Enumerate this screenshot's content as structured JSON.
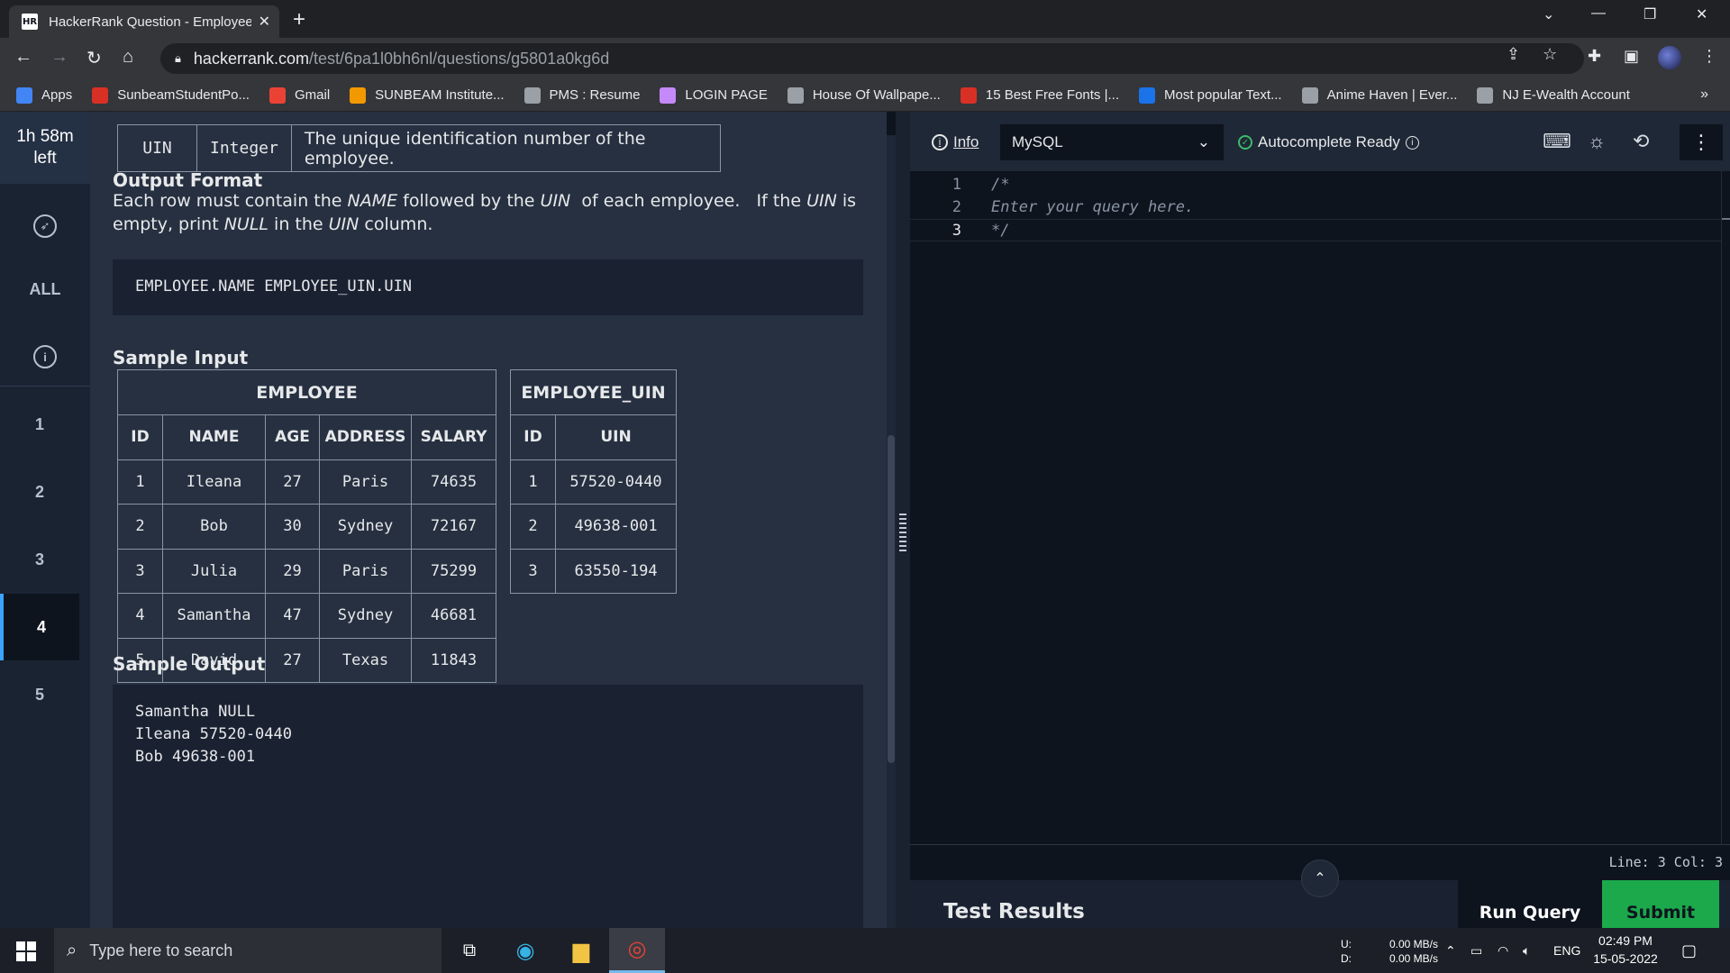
{
  "browser": {
    "tab_title": "HackerRank Question - Employee",
    "url_host": "hackerrank.com",
    "url_path": "/test/6pa1l0bh6nl/questions/g5801a0kg6d",
    "bookmarks": [
      {
        "label": "Apps",
        "color": "#4285f4"
      },
      {
        "label": "SunbeamStudentPo...",
        "color": "#d93025"
      },
      {
        "label": "Gmail",
        "color": "#ea4335"
      },
      {
        "label": "SUNBEAM Institute...",
        "color": "#f29900"
      },
      {
        "label": "PMS : Resume",
        "color": "#9aa0a6"
      },
      {
        "label": "LOGIN PAGE",
        "color": "#c58af9"
      },
      {
        "label": "House Of Wallpape...",
        "color": "#9aa0a6"
      },
      {
        "label": "15 Best Free Fonts |...",
        "color": "#d93025"
      },
      {
        "label": "Most popular Text...",
        "color": "#1a73e8"
      },
      {
        "label": "Anime Haven | Ever...",
        "color": "#9aa0a6"
      },
      {
        "label": "NJ E-Wealth Account",
        "color": "#9aa0a6"
      }
    ]
  },
  "rail": {
    "timer_line1": "1h 58m",
    "timer_line2": "left",
    "all_label": "ALL",
    "questions": [
      "1",
      "2",
      "3",
      "4",
      "5"
    ],
    "active_question": "4"
  },
  "problem": {
    "uin_row": {
      "field": "UIN",
      "type": "Integer",
      "desc": "The unique identification number of the employee."
    },
    "output_heading": "Output Format",
    "output_p1": "Each row must contain the ",
    "output_name": "NAME",
    "output_p2": " followed by the ",
    "output_uin1": "UIN",
    "output_p3": "  of each employee.   If the ",
    "output_uin2": "UIN",
    "output_p4": " is empty, print ",
    "output_null": "NULL",
    "output_p5": " in the ",
    "output_uin3": "UIN",
    "output_p6": " column.",
    "format_code": "EMPLOYEE.NAME EMPLOYEE_UIN.UIN",
    "sample_input_heading": "Sample Input",
    "employee_table": {
      "caption": "EMPLOYEE",
      "headers": [
        "ID",
        "NAME",
        "AGE",
        "ADDRESS",
        "SALARY"
      ],
      "rows": [
        [
          "1",
          "Ileana",
          "27",
          "Paris",
          "74635"
        ],
        [
          "2",
          "Bob",
          "30",
          "Sydney",
          "72167"
        ],
        [
          "3",
          "Julia",
          "29",
          "Paris",
          "75299"
        ],
        [
          "4",
          "Samantha",
          "47",
          "Sydney",
          "46681"
        ],
        [
          "5",
          "David",
          "27",
          "Texas",
          "11843"
        ]
      ]
    },
    "uin_table": {
      "caption": "EMPLOYEE_UIN",
      "headers": [
        "ID",
        "UIN"
      ],
      "rows": [
        [
          "1",
          "57520-0440"
        ],
        [
          "2",
          "49638-001"
        ],
        [
          "3",
          "63550-194"
        ]
      ]
    },
    "sample_output_heading": "Sample Output",
    "sample_output_lines": [
      "Samantha NULL",
      "Ileana 57520-0440",
      "Bob 49638-001"
    ]
  },
  "editor": {
    "info_label": "Info",
    "language": "MySQL",
    "autocomplete_label": "Autocomplete Ready",
    "code_lines": [
      "/*",
      "Enter your query here.",
      "*/"
    ],
    "line_numbers": [
      "1",
      "2",
      "3"
    ],
    "cursor_status": "Line: 3 Col: 3",
    "test_results_label": "Test Results",
    "run_label": "Run Query",
    "submit_label": "Submit"
  },
  "taskbar": {
    "search_placeholder": "Type here to search",
    "net_up_label": "U:",
    "net_down_label": "D:",
    "net_up": "0.00 MB/s",
    "net_down": "0.00 MB/s",
    "language": "ENG",
    "time": "02:49 PM",
    "date": "15-05-2022"
  }
}
